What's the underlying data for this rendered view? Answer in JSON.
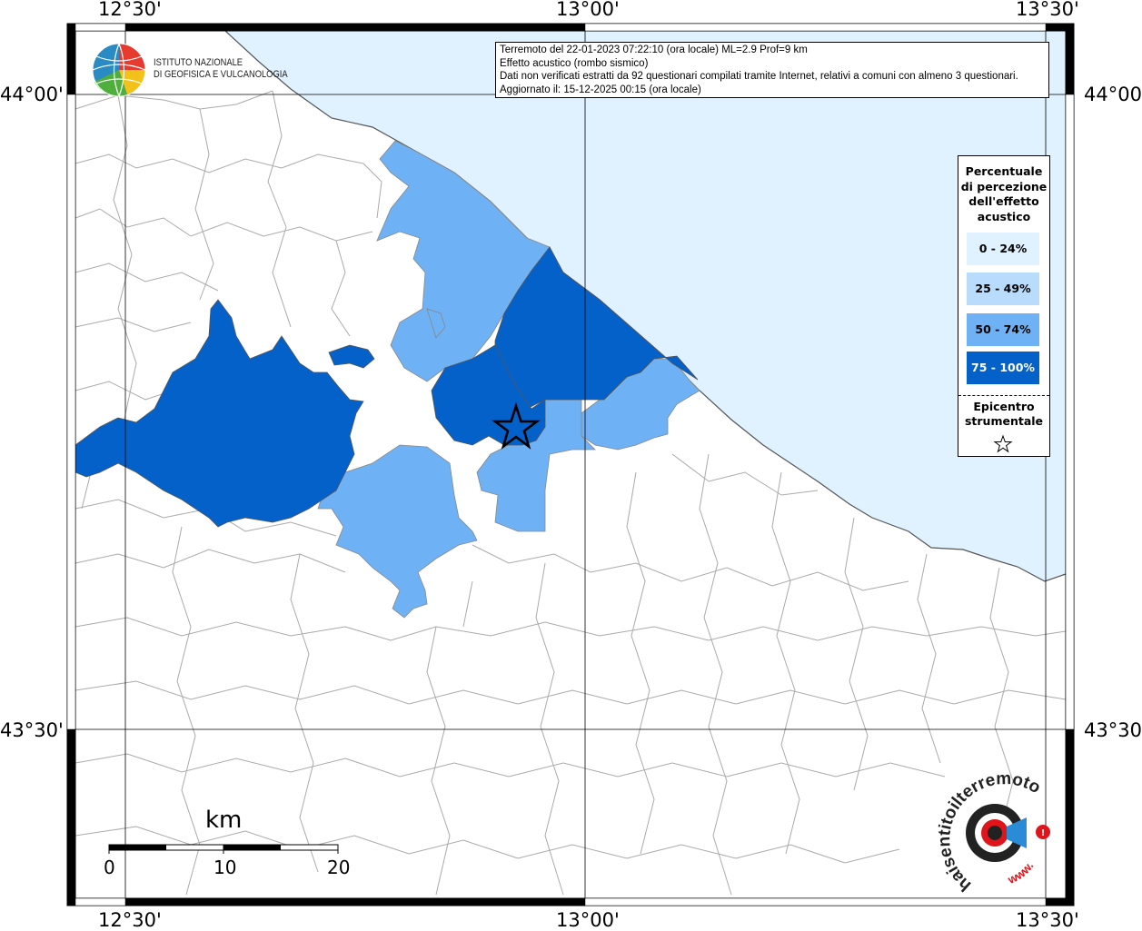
{
  "header": {
    "line1": "Terremoto del 22-01-2023 07:22:10 (ora locale) ML=2.9 Prof=9 km",
    "line2": "Effetto acustico (rombo sismico)",
    "line3": "Dati non verificati estratti da 92 questionari compilati tramite Internet, relativi a comuni con almeno 3 questionari.",
    "line4": "Aggiornato il: 15-12-2025 00:15 (ora locale)"
  },
  "coordinates": {
    "lon_left": "12°30'",
    "lon_center": "13°00'",
    "lon_right": "13°30'",
    "lat_top": "44°00'",
    "lat_bottom": "43°30'"
  },
  "legend": {
    "title": "Percentuale di percezione dell'effetto acustico",
    "title_lines": [
      "Percentuale",
      "di percezione",
      "dell'effetto",
      "acustico"
    ],
    "classes": [
      {
        "label": "0 - 24%",
        "color": "#e0f1ff",
        "text_color": "#000000"
      },
      {
        "label": "25 - 49%",
        "color": "#b9dcfc",
        "text_color": "#000000"
      },
      {
        "label": "50 - 74%",
        "color": "#6fb1f5",
        "text_color": "#000000"
      },
      {
        "label": "75 - 100%",
        "color": "#0461ca",
        "text_color": "#ffffff"
      }
    ],
    "epicenter_lines": [
      "Epicentro",
      "strumentale"
    ]
  },
  "logos": {
    "ingv_line1": "ISTITUTO NAZIONALE",
    "ingv_line2": "DI GEOFISICA E VULCANOLOGIA",
    "hsit_text": "haisentitoilterremoto.it",
    "hsit_www": "www."
  },
  "scale": {
    "unit": "km",
    "ticks": [
      "0",
      "10",
      "20"
    ]
  },
  "colors": {
    "sea": "#e0f1ff",
    "class_75_100": "#0461ca",
    "class_50_74": "#6fb1f5",
    "border": "#aaaaaa",
    "frame": "#000000"
  }
}
